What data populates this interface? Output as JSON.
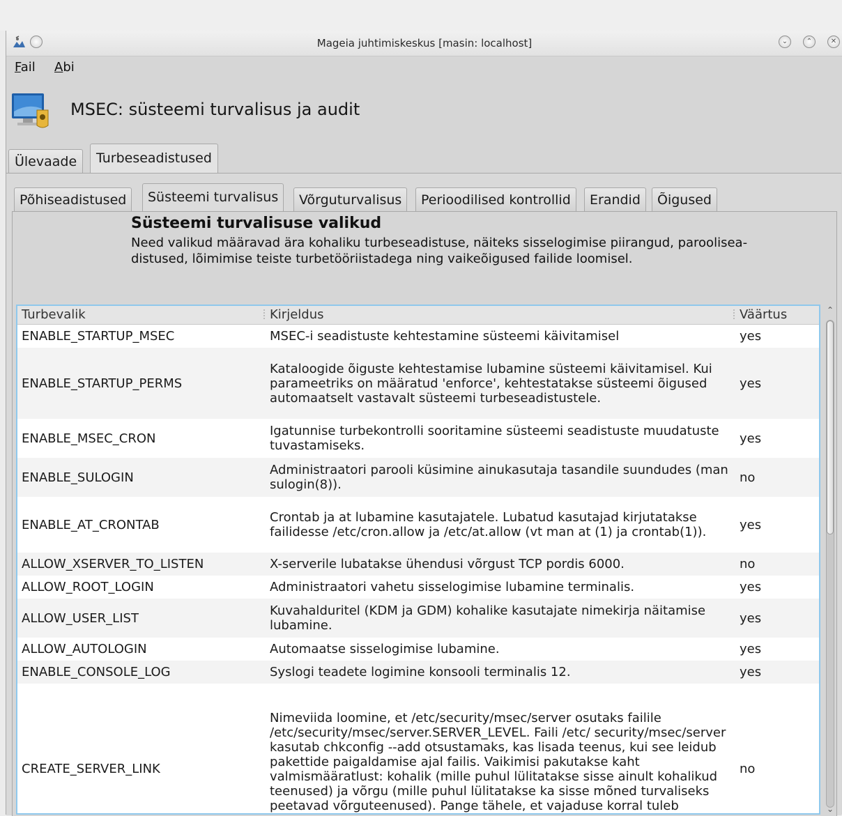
{
  "window": {
    "title": "Mageia juhtimiskeskus  [masin: localhost]"
  },
  "menu": {
    "file": "Fail",
    "help": "Abi"
  },
  "app": {
    "title": "MSEC: süsteemi turvalisus ja audit"
  },
  "outer_tabs": [
    {
      "label": "Ülevaade"
    },
    {
      "label": "Turbeseadistused"
    }
  ],
  "inner_tabs": [
    {
      "label": "Põhiseadistused"
    },
    {
      "label": "Süsteemi turvalisus"
    },
    {
      "label": "Võrguturvalisus"
    },
    {
      "label": "Perioodilised kontrollid"
    },
    {
      "label": "Erandid"
    },
    {
      "label": "Õigused"
    }
  ],
  "section": {
    "title": "Süsteemi turvalisuse valikud",
    "description": "Need valikud määravad ära kohaliku turbeseadistuse, näiteks sisselogimise piirangud, paroolisea­distused, lõimimise teiste turbetööriistadega ning vaikeõigused failide loomisel."
  },
  "table": {
    "headers": {
      "option": "Turbevalik",
      "description": "Kirjeldus",
      "value": "Väärtus"
    },
    "rows": [
      {
        "option": "ENABLE_STARTUP_MSEC",
        "description": "MSEC-i seadistuste kehtestamine süsteemi käivitamisel",
        "value": "yes"
      },
      {
        "option": "ENABLE_STARTUP_PERMS",
        "description": "Kataloogide õiguste kehtestamise lubamine süsteemi käivitamisel. Kui parameetriks on määratud 'enforce', kehtestatakse süsteemi õigused automaatselt vastavalt süsteemi turbeseadistustele.",
        "value": "yes"
      },
      {
        "option": "ENABLE_MSEC_CRON",
        "description": "Igatunnise turbekontrolli sooritamine süsteemi seadistuste muudatuste tuvastamiseks.",
        "value": "yes"
      },
      {
        "option": "ENABLE_SULOGIN",
        "description": "Administraatori parooli küsimine ainukasutaja tasandile suundudes (man sulogin(8)).",
        "value": "no"
      },
      {
        "option": "ENABLE_AT_CRONTAB",
        "description": "Crontab ja at lubamine kasutajatele. Lubatud kasutajad kirjutatakse failidesse /etc/cron.allow ja /etc/at.allow (vt man at (1) ja crontab(1)).",
        "value": "yes"
      },
      {
        "option": "ALLOW_XSERVER_TO_LISTEN",
        "description": "X-serverile lubatakse ühendusi võrgust TCP pordis 6000.",
        "value": "no"
      },
      {
        "option": "ALLOW_ROOT_LOGIN",
        "description": "Administraatori vahetu sisselogimise lubamine terminalis.",
        "value": "yes"
      },
      {
        "option": "ALLOW_USER_LIST",
        "description": "Kuvahalduritel (KDM ja GDM) kohalike kasutajate nimekirja näitamise lubamine.",
        "value": "yes"
      },
      {
        "option": "ALLOW_AUTOLOGIN",
        "description": "Automaatse sisselogimise lubamine.",
        "value": "yes"
      },
      {
        "option": "ENABLE_CONSOLE_LOG",
        "description": "Syslogi teadete logimine konsooli terminalis 12.",
        "value": "yes"
      },
      {
        "option": "CREATE_SERVER_LINK",
        "description": "Nimeviida loomine, et /etc/security/msec/server osutaks failile /etc/security/msec/server.SERVER_LEVEL. Faili /etc/ security/msec/server kasutab chkconfig --add otsustamaks, kas lisada teenus, kui see leidub pakettide paigaldamise ajal failis. Vaikimisi pakutakse kaht valmismääratlust: kohalik (mille puhul lülitatakse sisse ainult kohalikud teenused) ja võrgu (mille puhul lülitatakse ka sisse mõned turvaliseks peetavad võrguteenused). Pange tähele, et vajaduse korral tuleb lubatavad teenused sisestada server.SERVER_LEVEL",
        "value": "no"
      }
    ]
  },
  "scrollbar": {
    "position": 0.0,
    "visible_fraction": 0.44
  },
  "colors": {
    "table_focus_border": "#8fc8ec",
    "row_alt": "#f3f3f3"
  }
}
